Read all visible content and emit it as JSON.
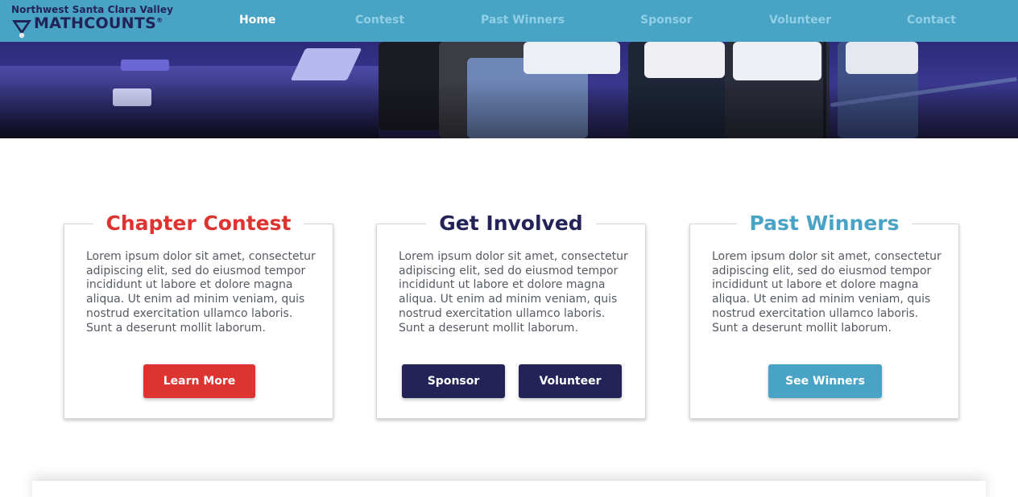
{
  "brand": {
    "region": "Northwest Santa Clara Valley",
    "name_math": "MATH",
    "name_counts": "COUNTS",
    "registered": "®",
    "colors": {
      "navy": "#232357",
      "red": "#de3431",
      "teal": "#48a3c4"
    }
  },
  "nav": {
    "items": [
      {
        "label": "Home",
        "active": true
      },
      {
        "label": "Contest",
        "active": false
      },
      {
        "label": "Past Winners",
        "active": false
      },
      {
        "label": "Sponsor",
        "active": false
      },
      {
        "label": "Volunteer",
        "active": false
      },
      {
        "label": "Contact",
        "active": false
      }
    ]
  },
  "cards": [
    {
      "title": "Chapter Contest",
      "title_color": "#de3431",
      "body": "Lorem ipsum dolor sit amet, consectetur adipiscing elit, sed do eiusmod tempor incididunt ut labore et dolore magna aliqua. Ut enim ad minim veniam, quis nostrud exercitation ullamco laboris. Sunt a deserunt mollit laborum.",
      "buttons": [
        {
          "label": "Learn More",
          "color": "#de3431"
        }
      ]
    },
    {
      "title": "Get Involved",
      "title_color": "#232357",
      "body": "Lorem ipsum dolor sit amet, consectetur adipiscing elit, sed do eiusmod tempor incididunt ut labore et dolore magna aliqua. Ut enim ad minim veniam, quis nostrud exercitation ullamco laboris. Sunt a deserunt mollit laborum.",
      "buttons": [
        {
          "label": "Sponsor",
          "color": "#232357"
        },
        {
          "label": "Volunteer",
          "color": "#232357"
        }
      ]
    },
    {
      "title": "Past Winners",
      "title_color": "#48a3c4",
      "body": "Lorem ipsum dolor sit amet, consectetur adipiscing elit, sed do eiusmod tempor incididunt ut labore et dolore magna aliqua. Ut enim ad minim veniam, quis nostrud exercitation ullamco laboris. Sunt a deserunt mollit laborum.",
      "buttons": [
        {
          "label": "See Winners",
          "color": "#48a3c4"
        }
      ]
    }
  ]
}
